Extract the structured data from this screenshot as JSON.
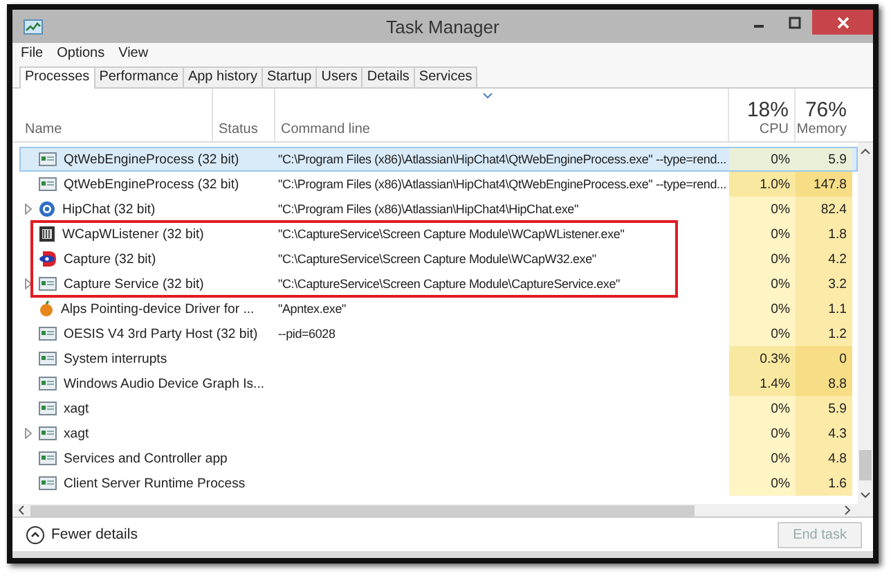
{
  "window": {
    "title": "Task Manager"
  },
  "menu": [
    "File",
    "Options",
    "View"
  ],
  "tabs": [
    {
      "label": "Processes",
      "selected": true
    },
    {
      "label": "Performance",
      "selected": false
    },
    {
      "label": "App history",
      "selected": false
    },
    {
      "label": "Startup",
      "selected": false
    },
    {
      "label": "Users",
      "selected": false
    },
    {
      "label": "Details",
      "selected": false
    },
    {
      "label": "Services",
      "selected": false
    }
  ],
  "columns": {
    "name": "Name",
    "status": "Status",
    "command": "Command line",
    "cpu_total": "18%",
    "cpu": "CPU",
    "memory_total": "76%",
    "memory": "Memory"
  },
  "rows": [
    {
      "kind": "app",
      "name": "QtWebEngineProcess (32 bit)",
      "command": "\"C:\\Program Files (x86)\\Atlassian\\HipChat4\\QtWebEngineProcess.exe\" --type=rend...",
      "cpu": "0%",
      "memory": "5.9",
      "selected": true,
      "expandable": false,
      "outlined": false,
      "hot": false
    },
    {
      "kind": "app",
      "name": "QtWebEngineProcess (32 bit)",
      "command": "\"C:\\Program Files (x86)\\Atlassian\\HipChat4\\QtWebEngineProcess.exe\" --type=rend...",
      "cpu": "1.0%",
      "memory": "147.8",
      "selected": false,
      "expandable": false,
      "outlined": false,
      "hot": true
    },
    {
      "kind": "chat",
      "name": "HipChat (32 bit)",
      "command": "\"C:\\Program Files (x86)\\Atlassian\\HipChat4\\HipChat.exe\"",
      "cpu": "0%",
      "memory": "82.4",
      "selected": false,
      "expandable": true,
      "outlined": false,
      "hot": false
    },
    {
      "kind": "film",
      "name": "WCapWListener (32 bit)",
      "command": "\"C:\\CaptureService\\Screen Capture Module\\WCapWListener.exe\"",
      "cpu": "0%",
      "memory": "1.8",
      "selected": false,
      "expandable": false,
      "outlined": true,
      "hot": false
    },
    {
      "kind": "capture",
      "name": "Capture (32 bit)",
      "command": "\"C:\\CaptureService\\Screen Capture Module\\WCapW32.exe\"",
      "cpu": "0%",
      "memory": "4.2",
      "selected": false,
      "expandable": false,
      "outlined": true,
      "hot": false
    },
    {
      "kind": "app",
      "name": "Capture Service (32 bit)",
      "command": "\"C:\\CaptureService\\Screen Capture Module\\CaptureService.exe\"",
      "cpu": "0%",
      "memory": "3.2",
      "selected": false,
      "expandable": true,
      "outlined": true,
      "hot": false
    },
    {
      "kind": "fruit",
      "name": "Alps Pointing-device Driver for ...",
      "command": "\"Apntex.exe\"",
      "cpu": "0%",
      "memory": "1.1",
      "selected": false,
      "expandable": false,
      "outlined": false,
      "hot": false
    },
    {
      "kind": "app",
      "name": "OESIS V4 3rd Party Host (32 bit)",
      "command": "--pid=6028",
      "cpu": "0%",
      "memory": "1.2",
      "selected": false,
      "expandable": false,
      "outlined": false,
      "hot": false
    },
    {
      "kind": "app",
      "name": "System interrupts",
      "cpu": "0.3%",
      "memory": "0",
      "selected": false,
      "expandable": false,
      "outlined": false,
      "hot": true
    },
    {
      "kind": "app",
      "name": "Windows Audio Device Graph Is...",
      "cpu": "1.4%",
      "memory": "8.8",
      "selected": false,
      "expandable": false,
      "outlined": false,
      "hot": true
    },
    {
      "kind": "app",
      "name": "xagt",
      "cpu": "0%",
      "memory": "5.9",
      "selected": false,
      "expandable": false,
      "outlined": false,
      "hot": false
    },
    {
      "kind": "app",
      "name": "xagt",
      "cpu": "0%",
      "memory": "4.3",
      "selected": false,
      "expandable": true,
      "outlined": false,
      "hot": false
    },
    {
      "kind": "app",
      "name": "Services and Controller app",
      "cpu": "0%",
      "memory": "4.8",
      "selected": false,
      "expandable": false,
      "outlined": false,
      "hot": false
    },
    {
      "kind": "app",
      "name": "Client Server Runtime Process",
      "cpu": "0%",
      "memory": "1.6",
      "selected": false,
      "expandable": false,
      "outlined": false,
      "hot": false
    }
  ],
  "footer": {
    "details": "Fewer details",
    "end_task": {
      "label": "End task",
      "disabled": true
    }
  }
}
